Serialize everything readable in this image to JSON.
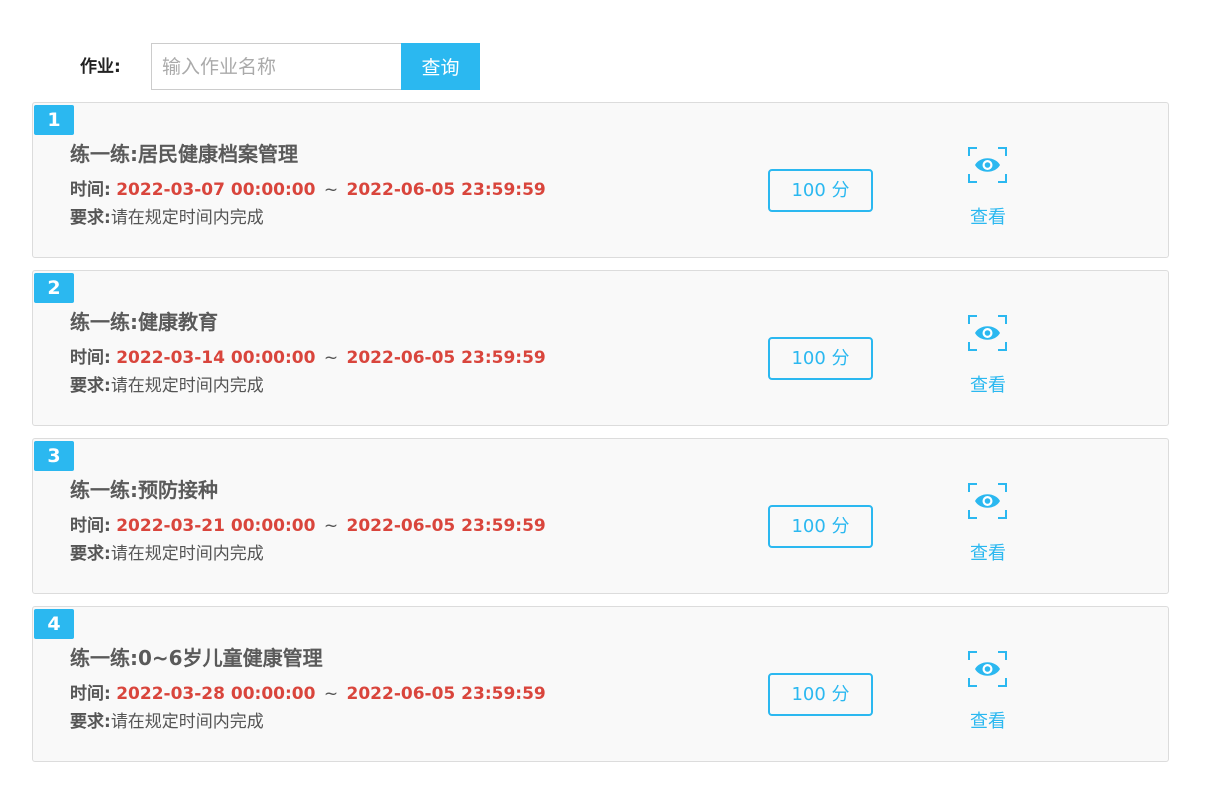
{
  "search": {
    "label": "作业:",
    "placeholder": "输入作业名称",
    "value": "",
    "button_label": "查询"
  },
  "colors": {
    "accent": "#2bb8f0",
    "date": "#d9453c",
    "text": "#555555",
    "card_bg": "#f9f9f9"
  },
  "assignments": [
    {
      "index": "1",
      "title": "练一练:居民健康档案管理",
      "time_label": "时间:",
      "start": "2022-03-07 00:00:00",
      "separator": "~",
      "end": "2022-06-05 23:59:59",
      "req_label": "要求:",
      "requirement": "请在规定时间内完成",
      "score": "100 分",
      "view_icon": "eye-icon",
      "view_label": "查看"
    },
    {
      "index": "2",
      "title": "练一练:健康教育",
      "time_label": "时间:",
      "start": "2022-03-14 00:00:00",
      "separator": "~",
      "end": "2022-06-05 23:59:59",
      "req_label": "要求:",
      "requirement": "请在规定时间内完成",
      "score": "100 分",
      "view_icon": "eye-icon",
      "view_label": "查看"
    },
    {
      "index": "3",
      "title": "练一练:预防接种",
      "time_label": "时间:",
      "start": "2022-03-21 00:00:00",
      "separator": "~",
      "end": "2022-06-05 23:59:59",
      "req_label": "要求:",
      "requirement": "请在规定时间内完成",
      "score": "100 分",
      "view_icon": "eye-icon",
      "view_label": "查看"
    },
    {
      "index": "4",
      "title": "练一练:0~6岁儿童健康管理",
      "time_label": "时间:",
      "start": "2022-03-28 00:00:00",
      "separator": "~",
      "end": "2022-06-05 23:59:59",
      "req_label": "要求:",
      "requirement": "请在规定时间内完成",
      "score": "100 分",
      "view_icon": "eye-icon",
      "view_label": "查看"
    }
  ]
}
